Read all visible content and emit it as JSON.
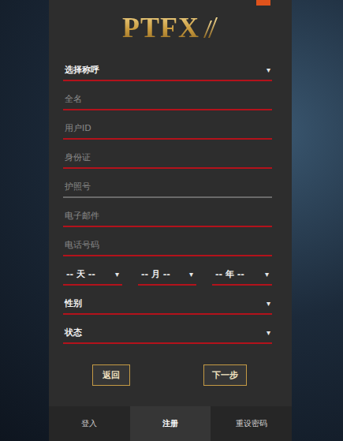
{
  "logo": {
    "text": "PTFX"
  },
  "fields": [
    {
      "kind": "select",
      "label": "选择称呼",
      "arrow": "▾",
      "color": "#b3121b"
    },
    {
      "kind": "input",
      "label": "全名",
      "color": "#b3121b"
    },
    {
      "kind": "input",
      "label": "用户ID",
      "color": "#b3121b"
    },
    {
      "kind": "input",
      "label": "身份证",
      "color": "#b3121b"
    },
    {
      "kind": "input",
      "label": "护照号",
      "color": "#6a6a6a"
    },
    {
      "kind": "input",
      "label": "电子邮件",
      "color": "#b3121b"
    },
    {
      "kind": "input",
      "label": "电话号码",
      "color": "#b3121b"
    },
    {
      "kind": "date",
      "color": "#b3121b",
      "parts": [
        {
          "label": "-- 天 --",
          "arrow": "▾"
        },
        {
          "label": "-- 月 --",
          "arrow": "▾"
        },
        {
          "label": "-- 年 --",
          "arrow": "▾"
        }
      ]
    },
    {
      "kind": "select",
      "label": "性别",
      "arrow": "▾",
      "color": "#b3121b"
    },
    {
      "kind": "select",
      "label": "状态",
      "arrow": "▾",
      "color": "#b3121b"
    }
  ],
  "buttons": [
    "返回",
    "下一步"
  ],
  "tabs": [
    {
      "label": "登入",
      "selected": false
    },
    {
      "label": "注册",
      "selected": true
    },
    {
      "label": "重设密码",
      "selected": false
    }
  ]
}
